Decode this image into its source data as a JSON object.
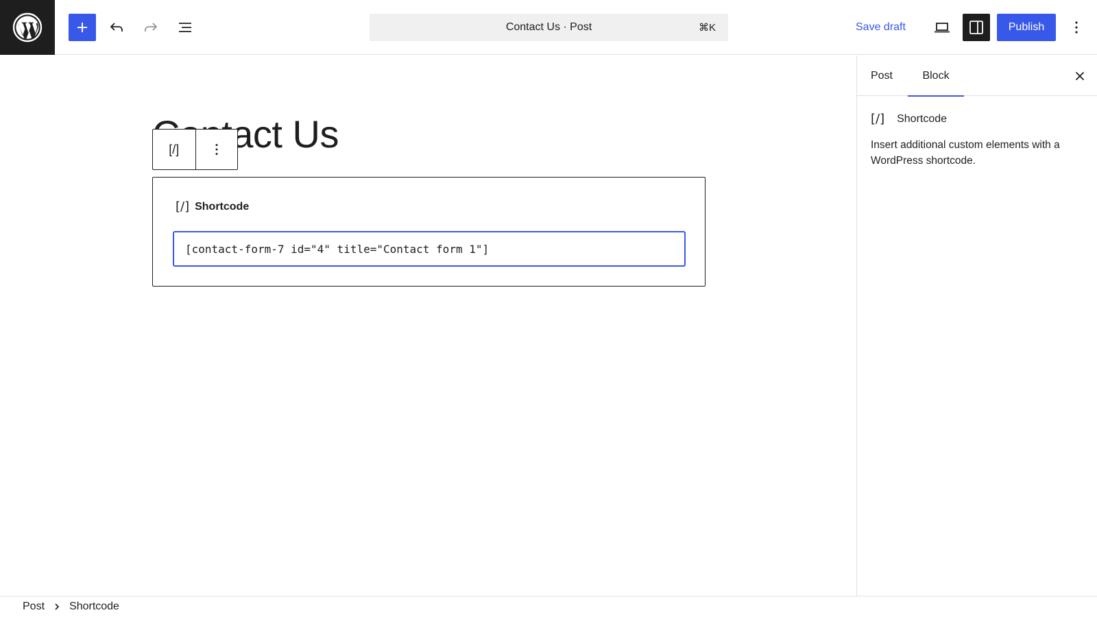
{
  "topbar": {
    "logo_icon": "wordpress-icon",
    "inserter_icon": "plus-icon",
    "undo_icon": "undo-icon",
    "redo_icon": "redo-icon",
    "listview_icon": "list-view-icon",
    "document_title": "Contact Us · Post",
    "command_shortcut": "⌘K",
    "save_draft_label": "Save draft",
    "preview_icon": "desktop-preview-icon",
    "settings_icon": "sidebar-settings-icon",
    "publish_label": "Publish",
    "more_icon": "more-vertical-icon",
    "accent_color": "#3858e9"
  },
  "editor": {
    "post_title": "Contact Us",
    "block_toolbar": {
      "block_icon_glyph": "[/]",
      "more_icon": "more-vertical-icon"
    },
    "shortcode_block": {
      "icon_glyph": "[/]",
      "label": "Shortcode",
      "value": "[contact-form-7 id=\"4\" title=\"Contact form 1\"]"
    }
  },
  "sidebar": {
    "tabs": [
      {
        "label": "Post"
      },
      {
        "label": "Block",
        "active": true
      }
    ],
    "close_icon": "close-icon",
    "block_card": {
      "icon_glyph": "[/]",
      "name": "Shortcode",
      "description": "Insert additional custom elements with a WordPress shortcode."
    }
  },
  "footer": {
    "breadcrumbs": [
      "Post",
      "Shortcode"
    ],
    "separator_icon": "chevron-right-icon"
  }
}
